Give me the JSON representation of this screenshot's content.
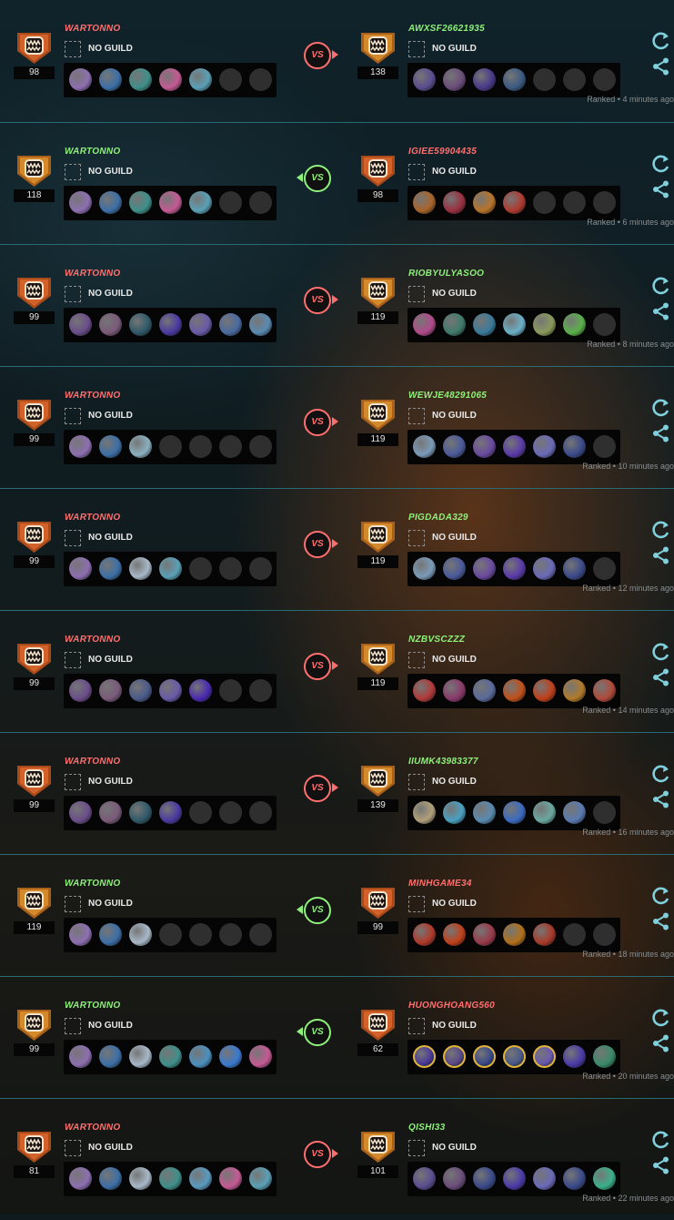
{
  "colors": {
    "win": "#8ef07a",
    "loss": "#ff6f6f",
    "empty_slot": "#2f2f2f",
    "divider": "#2a6a73"
  },
  "vs_label": "VS",
  "matches": [
    {
      "left": {
        "name": "WARTONNO",
        "result": "loss",
        "level": "98",
        "guild": "NO GUILD",
        "champs": [
          "#8d6fb0",
          "#3c6fa6",
          "#3f8f8a",
          "#c45a94",
          "#5aa0b6",
          "empty",
          "empty"
        ]
      },
      "right": {
        "name": "AWXSF26621935",
        "result": "win",
        "level": "138",
        "guild": "NO GUILD",
        "champs": [
          "#5b4d8f",
          "#6a4d7a",
          "#4a3a8a",
          "#3b5a82",
          "empty",
          "empty",
          "empty"
        ]
      },
      "vs_side": "right",
      "meta": "Ranked • 4 minutes ago"
    },
    {
      "left": {
        "name": "WARTONNO",
        "result": "win",
        "level": "118",
        "guild": "NO GUILD",
        "champs": [
          "#8d6fb0",
          "#3c6fa6",
          "#3f8f8a",
          "#c45a94",
          "#5aa0b6",
          "empty",
          "empty"
        ]
      },
      "right": {
        "name": "IGIEE59904435",
        "result": "loss",
        "level": "98",
        "guild": "NO GUILD",
        "champs": [
          "#a8642a",
          "#9a3040",
          "#b8742a",
          "#b03a30",
          "empty",
          "empty",
          "empty"
        ]
      },
      "vs_side": "left",
      "meta": "Ranked • 6 minutes ago"
    },
    {
      "left": {
        "name": "WARTONNO",
        "result": "loss",
        "level": "99",
        "guild": "NO GUILD",
        "champs": [
          "#6a4d8a",
          "#7a5a7a",
          "#2f5a6a",
          "#4a3aa0",
          "#6a5aa8",
          "#4a6aa0",
          "#5a8ab0"
        ]
      },
      "right": {
        "name": "RIOBYULYASOO",
        "result": "win",
        "level": "119",
        "guild": "NO GUILD",
        "champs": [
          "#b04a8a",
          "#3f7a6a",
          "#3a7a9a",
          "#6ab0c8",
          "#8a9a5a",
          "#5ab04a",
          "empty"
        ]
      },
      "vs_side": "right",
      "meta": "Ranked • 8 minutes ago"
    },
    {
      "left": {
        "name": "WARTONNO",
        "result": "loss",
        "level": "99",
        "guild": "NO GUILD",
        "champs": [
          "#8d6fb0",
          "#3c6fa6",
          "#8ab0c0",
          "empty",
          "empty",
          "empty",
          "empty"
        ]
      },
      "right": {
        "name": "WEWJE48291065",
        "result": "win",
        "level": "119",
        "guild": "NO GUILD",
        "champs": [
          "#7a9ab8",
          "#4a5a9a",
          "#6a4aa0",
          "#5a3aa8",
          "#6a6ab8",
          "#3a4a8a",
          "empty"
        ]
      },
      "vs_side": "right",
      "meta": "Ranked • 10 minutes ago"
    },
    {
      "left": {
        "name": "WARTONNO",
        "result": "loss",
        "level": "99",
        "guild": "NO GUILD",
        "champs": [
          "#8d6fb0",
          "#3c6fa6",
          "#a8b8c8",
          "#5aa0b6",
          "empty",
          "empty",
          "empty"
        ]
      },
      "right": {
        "name": "PIGDADA329",
        "result": "win",
        "level": "119",
        "guild": "NO GUILD",
        "champs": [
          "#7a9ab8",
          "#4a5a9a",
          "#6a4aa0",
          "#5a3aa8",
          "#6a6ab8",
          "#3a4a8a",
          "empty"
        ]
      },
      "vs_side": "right",
      "meta": "Ranked • 12 minutes ago"
    },
    {
      "left": {
        "name": "WARTONNO",
        "result": "loss",
        "level": "99",
        "guild": "NO GUILD",
        "champs": [
          "#6a4d8a",
          "#7a5a7a",
          "#4a5a8a",
          "#6a5aa8",
          "#4a2ab0",
          "empty",
          "empty"
        ]
      },
      "right": {
        "name": "NZBVSCZZZ",
        "result": "win",
        "level": "119",
        "guild": "NO GUILD",
        "champs": [
          "#b03a3a",
          "#8a3a6a",
          "#5a6a9a",
          "#c0501a",
          "#c0401a",
          "#b07a2a",
          "#b04a3a"
        ]
      },
      "vs_side": "right",
      "meta": "Ranked • 14 minutes ago"
    },
    {
      "left": {
        "name": "WARTONNO",
        "result": "loss",
        "level": "99",
        "guild": "NO GUILD",
        "champs": [
          "#6a4d8a",
          "#7a5a7a",
          "#2f5a6a",
          "#4a3aa0",
          "empty",
          "empty",
          "empty"
        ]
      },
      "right": {
        "name": "IIUMK43983377",
        "result": "win",
        "level": "139",
        "guild": "NO GUILD",
        "champs": [
          "#b0a07a",
          "#4aa0c0",
          "#5a8ab0",
          "#3a6ac0",
          "#6aa8a0",
          "#5a7ab0",
          "empty"
        ]
      },
      "vs_side": "right",
      "meta": "Ranked • 16 minutes ago"
    },
    {
      "left": {
        "name": "WARTONNO",
        "result": "win",
        "level": "119",
        "guild": "NO GUILD",
        "champs": [
          "#8d6fb0",
          "#3c6fa6",
          "#a8b8c8",
          "empty",
          "empty",
          "empty",
          "empty"
        ]
      },
      "right": {
        "name": "MINHGAME34",
        "result": "loss",
        "level": "99",
        "guild": "NO GUILD",
        "champs": [
          "#b03a2a",
          "#c0401a",
          "#9a3a4a",
          "#b0701a",
          "#a83a2a",
          "empty",
          "empty"
        ]
      },
      "vs_side": "left",
      "meta": "Ranked • 18 minutes ago"
    },
    {
      "left": {
        "name": "WARTONNO",
        "result": "win",
        "level": "99",
        "guild": "NO GUILD",
        "champs": [
          "#8d6fb0",
          "#3c6fa6",
          "#a8b8c8",
          "#3f8f8a",
          "#4a90c0",
          "#3a7ad0",
          "#c45a94"
        ]
      },
      "right": {
        "name": "HUONGHOANG560",
        "result": "loss",
        "level": "62",
        "guild": "NO GUILD",
        "champs": [
          "#4a3a9a",
          "#5a4a8a",
          "#3a4a8a",
          "#4a5a8a",
          "#6a5ab0",
          "#4a3aa8",
          "#3a8a6a"
        ],
        "ring": 5
      },
      "vs_side": "left",
      "meta": "Ranked • 20 minutes ago"
    },
    {
      "left": {
        "name": "WARTONNO",
        "result": "loss",
        "level": "81",
        "guild": "NO GUILD",
        "champs": [
          "#8d6fb0",
          "#3c6fa6",
          "#a8b8c8",
          "#3f8f8a",
          "#5a9ac0",
          "#c45a94",
          "#5aa0b6"
        ]
      },
      "right": {
        "name": "QISHI33",
        "result": "win",
        "level": "101",
        "guild": "NO GUILD",
        "champs": [
          "#5b4d8f",
          "#6a4d7a",
          "#3a4a8a",
          "#4a3aa8",
          "#6a6ab8",
          "#3a4a8a",
          "#3ab08a"
        ]
      },
      "vs_side": "right",
      "meta": "Ranked • 22 minutes ago"
    }
  ]
}
